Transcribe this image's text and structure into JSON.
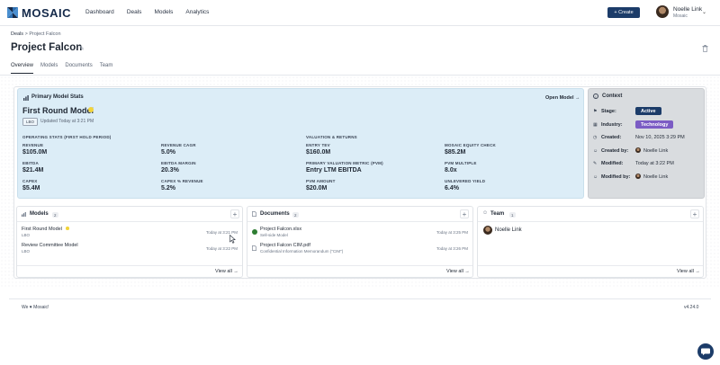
{
  "app": {
    "logo_text": "MOSAIC"
  },
  "nav": [
    "Dashboard",
    "Deals",
    "Models",
    "Analytics"
  ],
  "create_label": "+ Create",
  "user": {
    "name": "Noelle Link",
    "org": "Mosaic"
  },
  "breadcrumb": {
    "root": "Deals",
    "sep": " > ",
    "current": "Project Falcon"
  },
  "page_title": "Project Falcon",
  "tabs": [
    "Overview",
    "Models",
    "Documents",
    "Team"
  ],
  "stats": {
    "title": "Primary Model Stats",
    "open_model": "Open Model →",
    "model_name": "First Round Model",
    "model_tag": "LBO",
    "updated": "Updated Today at 3:21 PM",
    "op_header": "OPERATING STATS (FIRST HOLD PERIOD)",
    "val_header": "VALUATION & RETURNS",
    "op": [
      {
        "label": "REVENUE",
        "value": "$105.0M"
      },
      {
        "label": "REVENUE CAGR",
        "value": "5.0%"
      },
      {
        "label": "EBITDA",
        "value": "$21.4M"
      },
      {
        "label": "EBITDA MARGIN",
        "value": "20.3%"
      },
      {
        "label": "CAPEX",
        "value": "$5.4M"
      },
      {
        "label": "CAPEX % REVENUE",
        "value": "5.2%"
      }
    ],
    "val": [
      {
        "label": "ENTRY TEV",
        "value": "$160.0M"
      },
      {
        "label": "MOSAIC EQUITY CHECK",
        "value": "$85.2M"
      },
      {
        "label": "PRIMARY VALUATION METRIC (PVM)",
        "value": "Entry LTM EBITDA"
      },
      {
        "label": "PVM MULTIPLE",
        "value": "8.0x"
      },
      {
        "label": "PVM AMOUNT",
        "value": "$20.0M"
      },
      {
        "label": "UNLEVERED YIELD",
        "value": "6.4%"
      }
    ]
  },
  "context": {
    "title": "Context",
    "rows": [
      {
        "label": "Stage:",
        "value": "Active",
        "color": "#1c3c69"
      },
      {
        "label": "Industry:",
        "value": "Technology",
        "color": "#7b5cc4"
      },
      {
        "label": "Created:",
        "value": "Nov 10, 2025 3:29 PM"
      },
      {
        "label": "Created by:",
        "value": "Noelle Link"
      },
      {
        "label": "Modified:",
        "value": "Today at 3:22 PM"
      },
      {
        "label": "Modified by:",
        "value": "Noelle Link"
      }
    ]
  },
  "models_card": {
    "title": "Models",
    "count": "2",
    "view_all": "View all →",
    "items": [
      {
        "name": "First Round Model",
        "sub": "LBO",
        "time": "Today at 3:21 PM"
      },
      {
        "name": "Review Committee Model",
        "sub": "LBO",
        "time": "Today at 3:22 PM"
      }
    ]
  },
  "documents_card": {
    "title": "Documents",
    "count": "2",
    "view_all": "View all →",
    "items": [
      {
        "name": "Project Falcon.xlsx",
        "sub": "Sell-side Model",
        "time": "Today at 3:25 PM"
      },
      {
        "name": "Project Falcon CIM.pdf",
        "sub": "Confidential Information Memorandum (\"CIM\")",
        "time": "Today at 3:26 PM"
      }
    ]
  },
  "team_card": {
    "title": "Team",
    "count": "1",
    "view_all": "View all →",
    "items": [
      {
        "name": "Noelle Link"
      }
    ]
  },
  "footer": {
    "left": "We ♥ Mosaic!",
    "version": "v4.24.0"
  },
  "colors": {
    "brand": "#1c3c69",
    "stats_bg": "#dcedf7",
    "context_bg": "#d9dcdf",
    "star": "#f2d43a"
  }
}
